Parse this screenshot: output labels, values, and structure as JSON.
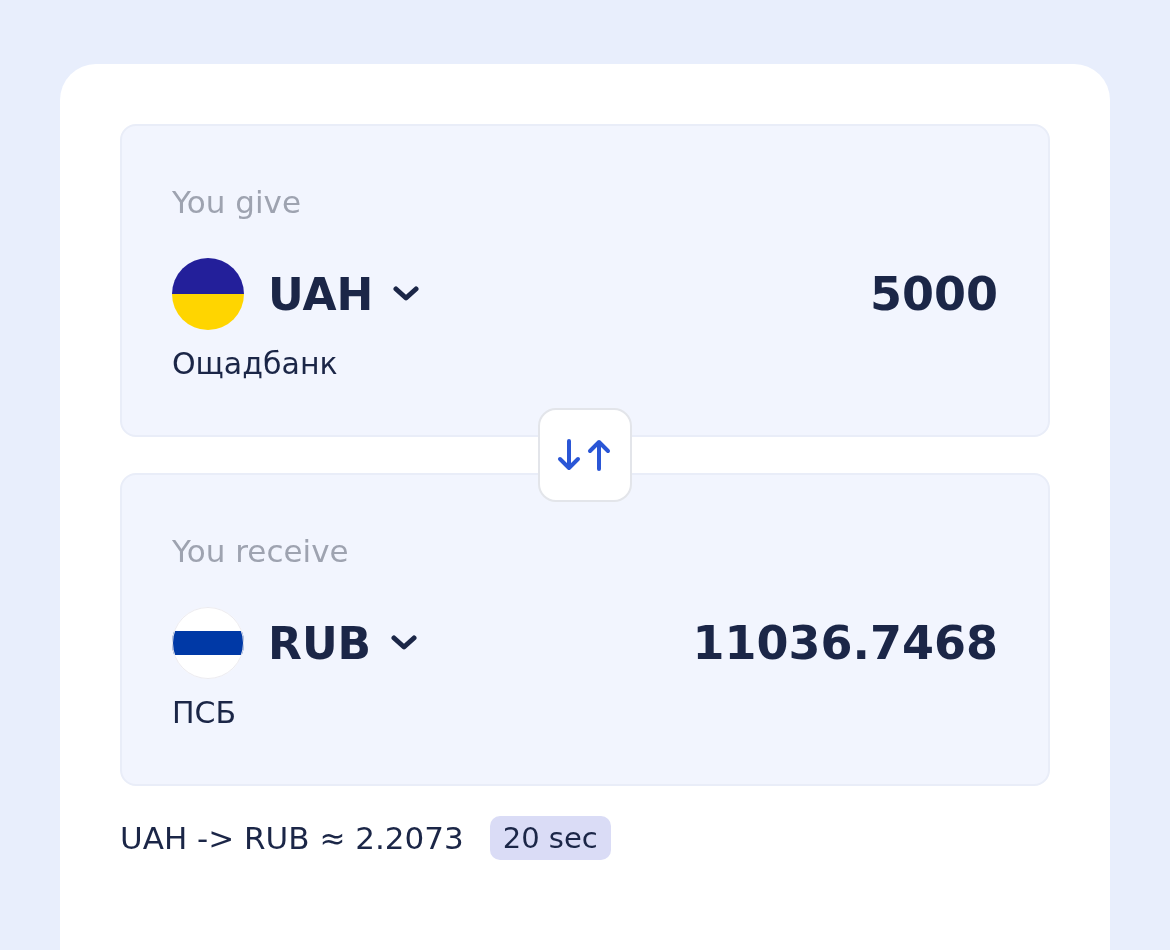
{
  "give": {
    "label": "You give",
    "flag": {
      "kind": "ua"
    },
    "currency": "UAH",
    "amount": "5000",
    "bank": "Ощадбанк"
  },
  "receive": {
    "label": "You receive",
    "flag": {
      "kind": "ru"
    },
    "currency": "RUB",
    "amount": "11036.7468",
    "bank": "ПСБ"
  },
  "rate": {
    "text": "UAH -> RUB ≈ 2.2073",
    "timer": "20 sec"
  }
}
